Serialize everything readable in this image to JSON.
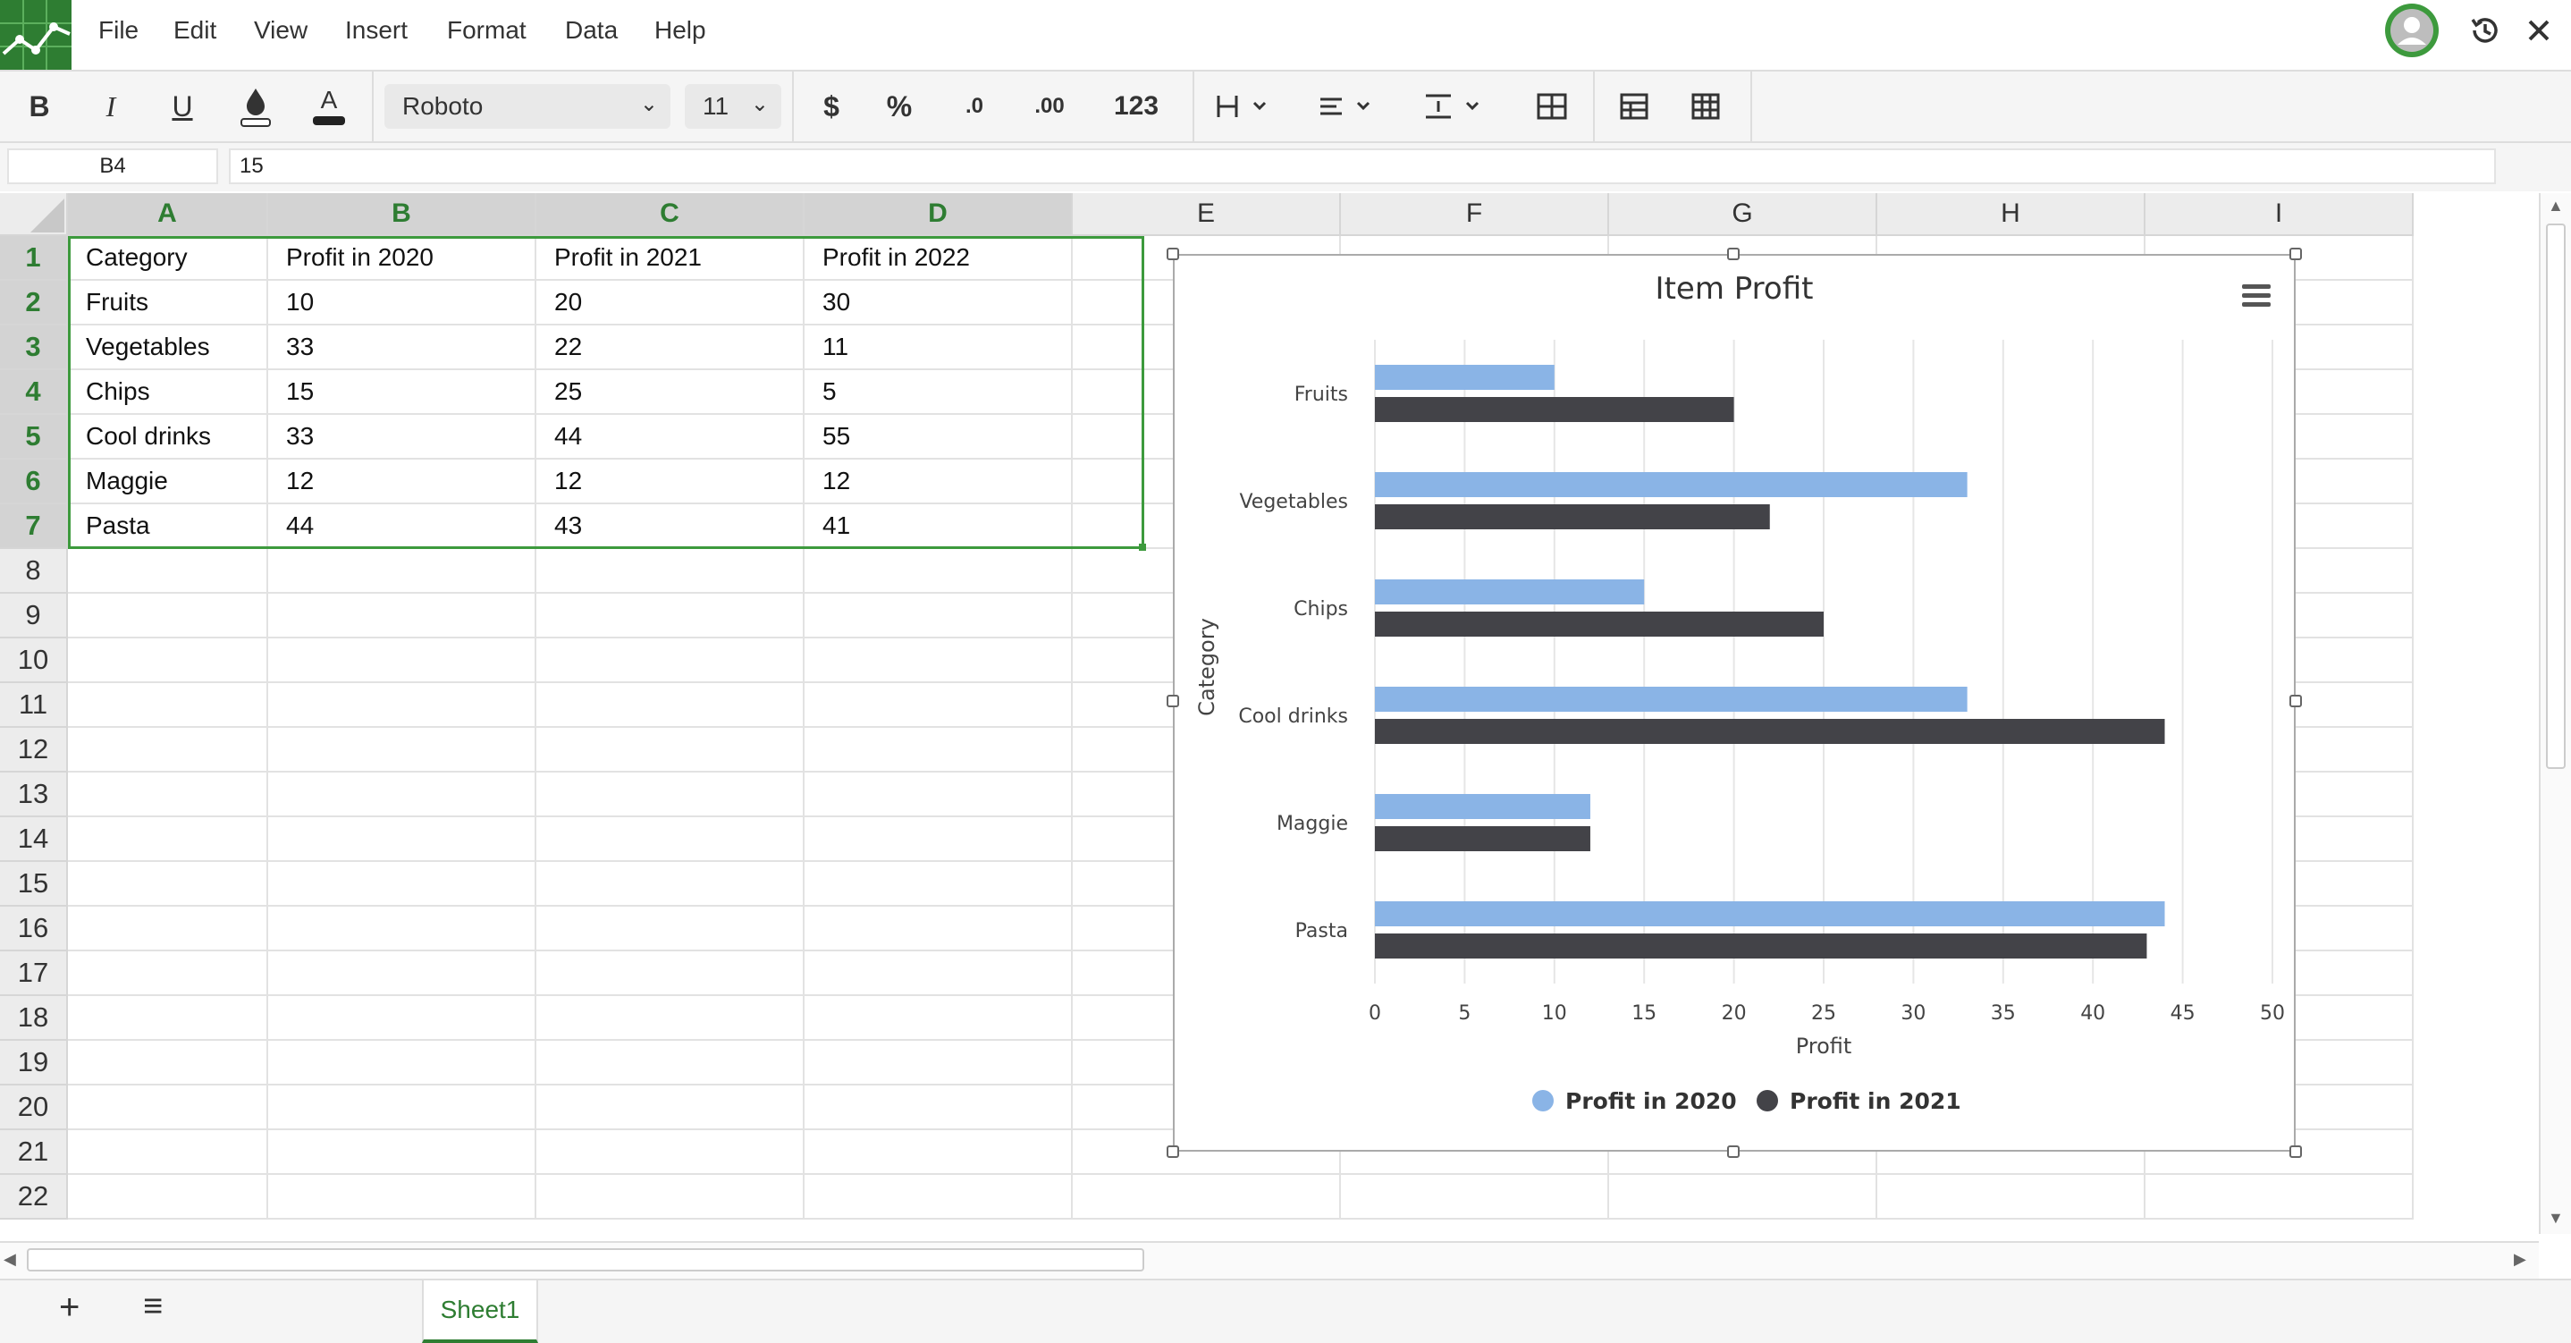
{
  "menubar": {
    "items": [
      "File",
      "Edit",
      "View",
      "Insert",
      "Format",
      "Data",
      "Help"
    ]
  },
  "toolbar": {
    "bold": "B",
    "italic": "I",
    "underline": "U",
    "text_color": "A",
    "font": "Roboto",
    "font_size": "11",
    "currency": "$",
    "percent": "%",
    "decrease_decimals": ".0",
    "increase_decimals": ".00",
    "number_format": "123"
  },
  "formula": {
    "cell_ref": "B4",
    "value": "15"
  },
  "columns": [
    "A",
    "B",
    "C",
    "D",
    "E",
    "F",
    "G",
    "H",
    "I"
  ],
  "rows": [
    "1",
    "2",
    "3",
    "4",
    "5",
    "6",
    "7",
    "8",
    "9",
    "10",
    "11",
    "12",
    "13",
    "14",
    "15",
    "16",
    "17",
    "18",
    "19",
    "20",
    "21",
    "22"
  ],
  "cells": [
    [
      "Category",
      "Profit in 2020",
      "Profit in 2021",
      "Profit in 2022"
    ],
    [
      "Fruits",
      "10",
      "20",
      "30"
    ],
    [
      "Vegetables",
      "33",
      "22",
      "11"
    ],
    [
      "Chips",
      "15",
      "25",
      "5"
    ],
    [
      "Cool drinks",
      "33",
      "44",
      "55"
    ],
    [
      "Maggie",
      "12",
      "12",
      "12"
    ],
    [
      "Pasta",
      "44",
      "43",
      "41"
    ]
  ],
  "chart_data": {
    "type": "bar",
    "orientation": "horizontal",
    "title": "Item Profit",
    "xlabel": "Profit",
    "ylabel": "Category",
    "categories": [
      "Fruits",
      "Vegetables",
      "Chips",
      "Cool drinks",
      "Maggie",
      "Pasta"
    ],
    "series": [
      {
        "name": "Profit in 2020",
        "values": [
          10,
          33,
          15,
          33,
          12,
          44
        ],
        "color": "#8ab4e6"
      },
      {
        "name": "Profit in 2021",
        "values": [
          20,
          22,
          25,
          44,
          12,
          43
        ],
        "color": "#434348"
      }
    ],
    "xlim": [
      0,
      50
    ],
    "xticks": [
      "0",
      "5",
      "10",
      "15",
      "20",
      "25",
      "30",
      "35",
      "40",
      "45",
      "50"
    ],
    "grid": true,
    "legend": "bottom"
  },
  "sheets": {
    "add": "+",
    "list": "≡",
    "tabs": [
      "Sheet1"
    ]
  },
  "colors": {
    "accent": "#2e7d32",
    "selection": "#3d9a3d"
  }
}
